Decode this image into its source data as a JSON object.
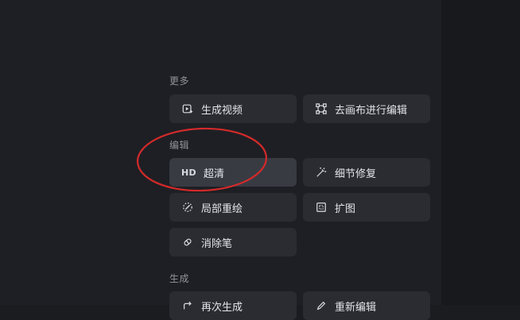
{
  "sections": {
    "more": {
      "title": "更多",
      "buttons": [
        {
          "label": "生成视频",
          "icon": "video-play-icon"
        },
        {
          "label": "去画布进行编辑",
          "icon": "canvas-frame-icon"
        }
      ]
    },
    "edit": {
      "title": "编辑",
      "buttons": [
        {
          "label": "超清",
          "icon": "hd-icon",
          "icon_text": "HD",
          "selected": true
        },
        {
          "label": "细节修复",
          "icon": "magic-wand-icon"
        },
        {
          "label": "局部重绘",
          "icon": "brush-icon"
        },
        {
          "label": "扩图",
          "icon": "expand-frame-icon"
        },
        {
          "label": "消除笔",
          "icon": "eraser-icon"
        }
      ]
    },
    "generate": {
      "title": "生成",
      "buttons": [
        {
          "label": "再次生成",
          "icon": "regenerate-icon"
        },
        {
          "label": "重新编辑",
          "icon": "pencil-icon"
        }
      ]
    }
  },
  "annotation_color": "#d42a2a"
}
